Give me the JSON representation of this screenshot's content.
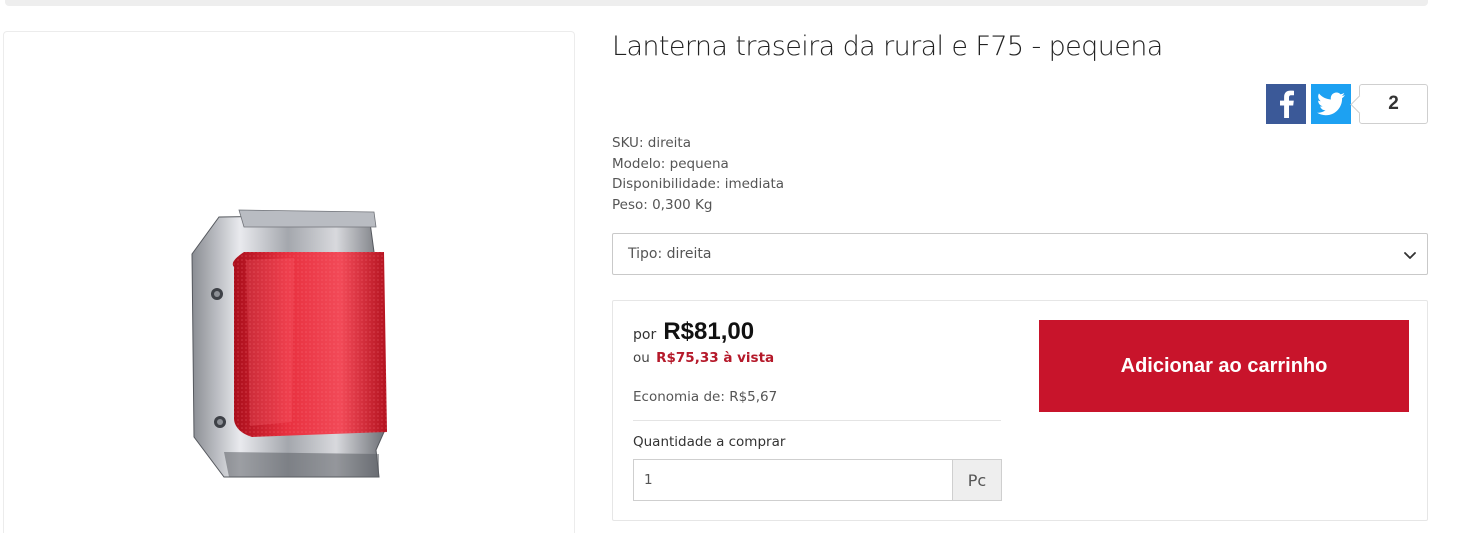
{
  "product": {
    "title": "Lanterna traseira da rural e F75 - pequena",
    "image_alt": "Lanterna traseira vermelha com moldura cromada"
  },
  "share": {
    "facebook_icon": "facebook-icon",
    "twitter_icon": "twitter-icon",
    "count": "2",
    "colors": {
      "facebook": "#3b5998",
      "twitter": "#1da1f2"
    }
  },
  "specs": [
    {
      "text": "SKU: direita"
    },
    {
      "text": "Modelo: pequena"
    },
    {
      "text": "Disponibilidade: imediata"
    },
    {
      "text": "Peso: 0,300 Kg"
    }
  ],
  "variant": {
    "selected": "Tipo: direita",
    "icon": "chevron-down-icon"
  },
  "pricing": {
    "prefix": "por",
    "price": "R$81,00",
    "cash_prefix": "ou",
    "cash_price": "R$75,33 à vista",
    "economy": "Economia de: R$5,67"
  },
  "quantity": {
    "label": "Quantidade a comprar",
    "value": "1",
    "unit": "Pc"
  },
  "cart": {
    "button_label": "Adicionar ao carrinho",
    "color": "#c8142b"
  }
}
